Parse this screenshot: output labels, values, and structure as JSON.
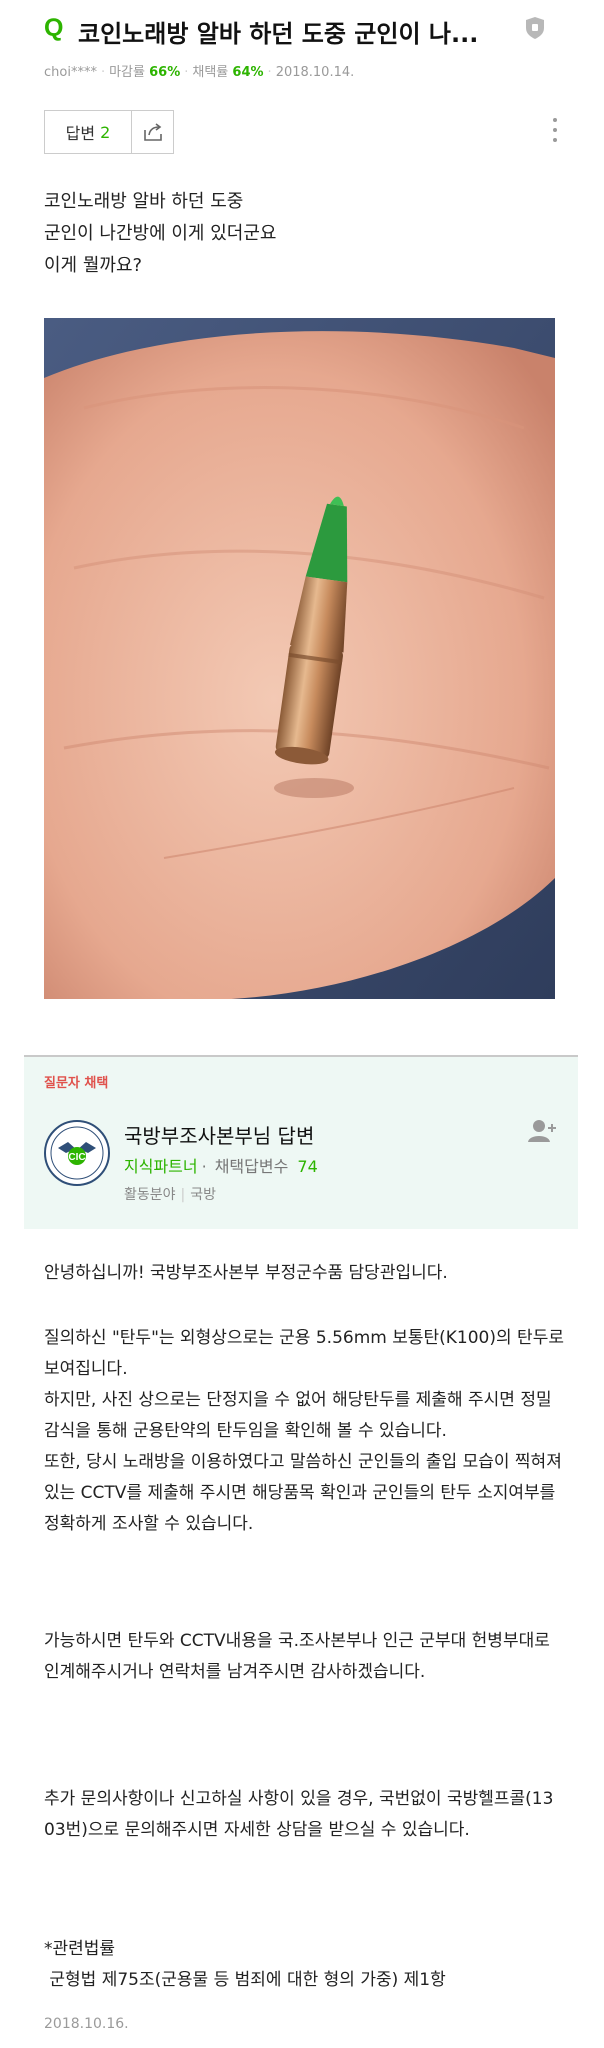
{
  "header": {
    "q_badge": "Q",
    "title": "코인노래방 알바 하던 도중 군인이 나...",
    "meta": {
      "user": "choi****",
      "close_rate_label": "마감률",
      "close_rate": "66%",
      "adopt_rate_label": "채택률",
      "adopt_rate": "64%",
      "date": "2018.10.14."
    }
  },
  "toolbar": {
    "answer_label": "답변",
    "answer_count": "2"
  },
  "question": {
    "lines": [
      "코인노래방 알바 하던 도중",
      "군인이 나간방에 이게 있더군요",
      "이게 뭘까요?"
    ]
  },
  "answer": {
    "chosen_label": "질문자 채택",
    "author_name": "국방부조사본부님 답변",
    "partner_label": "지식파트너",
    "adopted_count_label": "채택답변수",
    "adopted_count": "74",
    "field_label": "활동분야",
    "field_value": "국방",
    "paragraphs": [
      "안녕하십니까! 국방부조사본부 부정군수품 담당관입니다.",
      "질의하신 \"탄두\"는 외형상으로는 군용 5.56mm 보통탄(K100)의 탄두로 보여집니다.\n하지만, 사진 상으로는 단정지을 수 없어 해당탄두를 제출해 주시면 정밀감식을 통해 군용탄약의 탄두임을 확인해 볼 수 있습니다.\n또한, 당시 노래방을 이용하였다고 말씀하신 군인들의 출입 모습이 찍혀져 있는 CCTV를 제출해 주시면 해당품목 확인과 군인들의 탄두 소지여부를 정확하게 조사할 수 있습니다.",
      "가능하시면 탄두와 CCTV내용을 국.조사본부나 인근 군부대 헌병부대로 인계해주시거나 연락처를 남겨주시면 감사하겠습니다.",
      "추가 문의사항이나 신고하실 사항이 있을 경우, 국번없이 국방헬프콜(1303번)으로 문의해주시면 자세한 상담을 받으실 수 있습니다.",
      "*관련법률\n 군형법 제75조(군용물 등 범죄에 대한 형의 가중) 제1항"
    ],
    "date": "2018.10.16."
  },
  "colors": {
    "accent_green": "#2db400",
    "chosen_red": "#e0524c",
    "answer_bg": "#eef8f4"
  },
  "icons": [
    "shield-icon",
    "share-icon",
    "more-vertical-icon",
    "add-friend-icon",
    "emblem-icon"
  ]
}
